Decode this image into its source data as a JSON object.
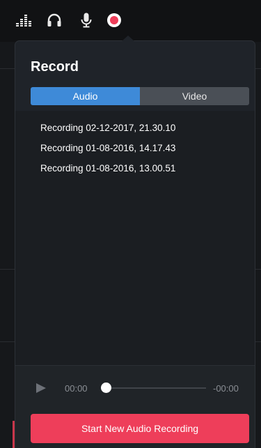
{
  "toolbar": {
    "icons": [
      "equalizer-icon",
      "headphones-icon",
      "microphone-icon",
      "record-icon"
    ],
    "active_icon": "record-icon"
  },
  "popover": {
    "title": "Record",
    "tabs": [
      {
        "label": "Audio",
        "active": true
      },
      {
        "label": "Video",
        "active": false
      }
    ],
    "recordings": [
      "Recording 02-12-2017, 21.30.10",
      "Recording 01-08-2016, 14.17.43",
      "Recording 01-08-2016, 13.00.51"
    ]
  },
  "player": {
    "elapsed": "00:00",
    "remaining": "-00:00",
    "progress": 0
  },
  "actions": {
    "start_label": "Start New Audio Recording"
  },
  "colors": {
    "accent_blue": "#3e8ad8",
    "record_red": "#ee3e5a",
    "panel": "#1f2329"
  }
}
